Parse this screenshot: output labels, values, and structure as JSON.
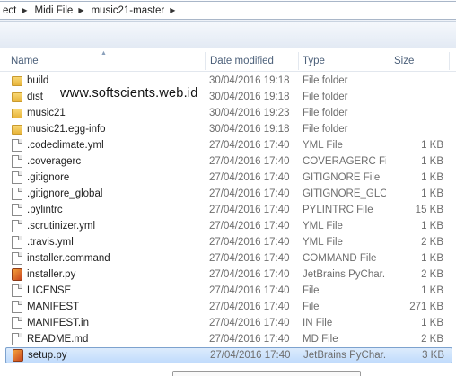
{
  "breadcrumb": [
    {
      "label": "ect"
    },
    {
      "label": "Midi File"
    },
    {
      "label": "music21-master"
    }
  ],
  "watermark": "www.softscients.web.id",
  "columns": {
    "name": "Name",
    "date_modified": "Date modified",
    "type": "Type",
    "size": "Size"
  },
  "files": [
    {
      "name": "build",
      "date": "30/04/2016 19:18",
      "type": "File folder",
      "size": "",
      "icon": "folder-icon"
    },
    {
      "name": "dist",
      "date": "30/04/2016 19:18",
      "type": "File folder",
      "size": "",
      "icon": "folder-icon"
    },
    {
      "name": "music21",
      "date": "30/04/2016 19:23",
      "type": "File folder",
      "size": "",
      "icon": "folder-icon"
    },
    {
      "name": "music21.egg-info",
      "date": "30/04/2016 19:18",
      "type": "File folder",
      "size": "",
      "icon": "folder-icon"
    },
    {
      "name": ".codeclimate.yml",
      "date": "27/04/2016 17:40",
      "type": "YML File",
      "size": "1 KB",
      "icon": "file-icon"
    },
    {
      "name": ".coveragerc",
      "date": "27/04/2016 17:40",
      "type": "COVERAGERC File",
      "size": "1 KB",
      "icon": "file-icon"
    },
    {
      "name": ".gitignore",
      "date": "27/04/2016 17:40",
      "type": "GITIGNORE File",
      "size": "1 KB",
      "icon": "file-icon"
    },
    {
      "name": ".gitignore_global",
      "date": "27/04/2016 17:40",
      "type": "GITIGNORE_GLOB...",
      "size": "1 KB",
      "icon": "file-icon"
    },
    {
      "name": ".pylintrc",
      "date": "27/04/2016 17:40",
      "type": "PYLINTRC File",
      "size": "15 KB",
      "icon": "file-icon"
    },
    {
      "name": ".scrutinizer.yml",
      "date": "27/04/2016 17:40",
      "type": "YML File",
      "size": "1 KB",
      "icon": "file-icon"
    },
    {
      "name": ".travis.yml",
      "date": "27/04/2016 17:40",
      "type": "YML File",
      "size": "2 KB",
      "icon": "file-icon"
    },
    {
      "name": "installer.command",
      "date": "27/04/2016 17:40",
      "type": "COMMAND File",
      "size": "1 KB",
      "icon": "file-icon"
    },
    {
      "name": "installer.py",
      "date": "27/04/2016 17:40",
      "type": "JetBrains PyChar...",
      "size": "2 KB",
      "icon": "pycharm-file-icon"
    },
    {
      "name": "LICENSE",
      "date": "27/04/2016 17:40",
      "type": "File",
      "size": "1 KB",
      "icon": "file-icon"
    },
    {
      "name": "MANIFEST",
      "date": "27/04/2016 17:40",
      "type": "File",
      "size": "271 KB",
      "icon": "file-icon"
    },
    {
      "name": "MANIFEST.in",
      "date": "27/04/2016 17:40",
      "type": "IN File",
      "size": "1 KB",
      "icon": "file-icon"
    },
    {
      "name": "README.md",
      "date": "27/04/2016 17:40",
      "type": "MD File",
      "size": "2 KB",
      "icon": "file-icon"
    },
    {
      "name": "setup.py",
      "date": "27/04/2016 17:40",
      "type": "JetBrains PyChar...",
      "size": "3 KB",
      "icon": "pycharm-file-icon",
      "selected": true
    }
  ],
  "colors": {
    "selection": "#c1dcfc",
    "selection_border": "#7da2ce",
    "header_text": "#4c607a",
    "secondary_text": "#6d6d6d"
  }
}
